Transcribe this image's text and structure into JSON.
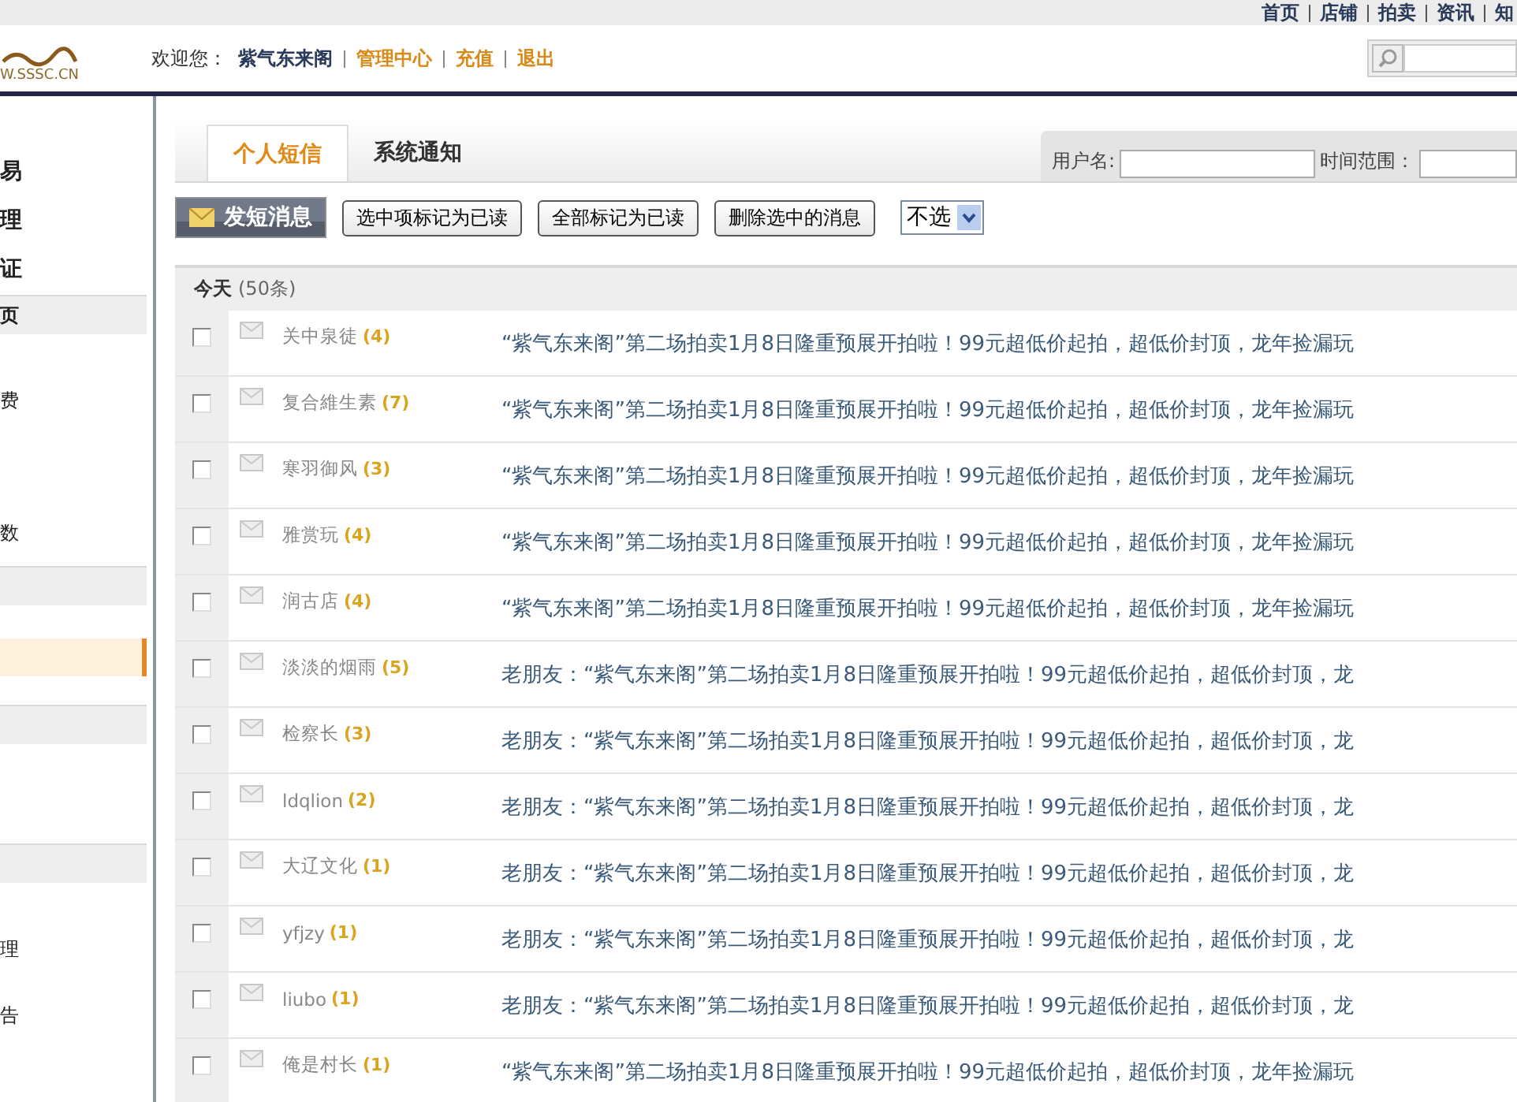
{
  "top_nav": [
    "首页",
    "店铺",
    "拍卖",
    "资讯",
    "知"
  ],
  "logo": {
    "text": "W.SSSC.CN"
  },
  "header": {
    "greeting": "欢迎您：",
    "username": "紫气东来阁",
    "links": [
      "管理中心",
      "充值",
      "退出"
    ]
  },
  "sidebar": {
    "items": [
      {
        "kind": "big",
        "label": "易",
        "selected": false
      },
      {
        "kind": "big",
        "label": "理",
        "selected": false
      },
      {
        "kind": "big",
        "label": "证",
        "selected": false
      },
      {
        "kind": "header",
        "label": "页"
      },
      {
        "kind": "item",
        "label": "费",
        "selected": false
      },
      {
        "kind": "item",
        "selected": false
      },
      {
        "kind": "item",
        "label": "数",
        "selected": false
      },
      {
        "kind": "header"
      },
      {
        "kind": "item",
        "selected": true
      },
      {
        "kind": "header"
      },
      {
        "kind": "item",
        "selected": false
      },
      {
        "kind": "header"
      },
      {
        "kind": "item",
        "label": "理",
        "selected": false
      },
      {
        "kind": "item",
        "label": "告",
        "selected": false
      }
    ]
  },
  "tabs": [
    {
      "label": "个人短信",
      "selected": true
    },
    {
      "label": "系统通知",
      "selected": false
    }
  ],
  "filters": {
    "username_label": "用户名:",
    "time_label": "时间范围："
  },
  "toolbar": {
    "compose": "发短消息",
    "buttons": [
      "选中项标记为已读",
      "全部标记为已读",
      "删除选中的消息"
    ],
    "select": "不选"
  },
  "group": {
    "title": "今天",
    "count": "(50条)"
  },
  "messages": [
    {
      "sender": "关中泉徒",
      "count": "(4)",
      "subject": "“紫气东来阁”第二场拍卖1月8日隆重预展开拍啦！99元超低价起拍，超低价封顶，龙年捡漏玩",
      "checked": false
    },
    {
      "sender": "复合維生素",
      "count": "(7)",
      "subject": "“紫气东来阁”第二场拍卖1月8日隆重预展开拍啦！99元超低价起拍，超低价封顶，龙年捡漏玩",
      "checked": false
    },
    {
      "sender": "寒羽御风",
      "count": "(3)",
      "subject": "“紫气东来阁”第二场拍卖1月8日隆重预展开拍啦！99元超低价起拍，超低价封顶，龙年捡漏玩",
      "checked": false
    },
    {
      "sender": "雅赏玩",
      "count": "(4)",
      "subject": "“紫气东来阁”第二场拍卖1月8日隆重预展开拍啦！99元超低价起拍，超低价封顶，龙年捡漏玩",
      "checked": false
    },
    {
      "sender": "润古店",
      "count": "(4)",
      "subject": "“紫气东来阁”第二场拍卖1月8日隆重预展开拍啦！99元超低价起拍，超低价封顶，龙年捡漏玩",
      "checked": false
    },
    {
      "sender": "淡淡的烟雨",
      "count": "(5)",
      "subject": "老朋友：“紫气东来阁”第二场拍卖1月8日隆重预展开拍啦！99元超低价起拍，超低价封顶，龙",
      "checked": false
    },
    {
      "sender": "检察长",
      "count": "(3)",
      "subject": "老朋友：“紫气东来阁”第二场拍卖1月8日隆重预展开拍啦！99元超低价起拍，超低价封顶，龙",
      "checked": false
    },
    {
      "sender": "ldqlion",
      "count": "(2)",
      "subject": "老朋友：“紫气东来阁”第二场拍卖1月8日隆重预展开拍啦！99元超低价起拍，超低价封顶，龙",
      "checked": false
    },
    {
      "sender": "大辽文化",
      "count": "(1)",
      "subject": "老朋友：“紫气东来阁”第二场拍卖1月8日隆重预展开拍啦！99元超低价起拍，超低价封顶，龙",
      "checked": false
    },
    {
      "sender": "yfjzy",
      "count": "(1)",
      "subject": "老朋友：“紫气东来阁”第二场拍卖1月8日隆重预展开拍啦！99元超低价起拍，超低价封顶，龙",
      "checked": false
    },
    {
      "sender": "liubo",
      "count": "(1)",
      "subject": "老朋友：“紫气东来阁”第二场拍卖1月8日隆重预展开拍啦！99元超低价起拍，超低价封顶，龙",
      "checked": false
    },
    {
      "sender": "俺是村长",
      "count": "(1)",
      "subject": "“紫气东来阁”第二场拍卖1月8日隆重预展开拍啦！99元超低价起拍，超低价封顶，龙年捡漏玩",
      "checked": false
    }
  ]
}
